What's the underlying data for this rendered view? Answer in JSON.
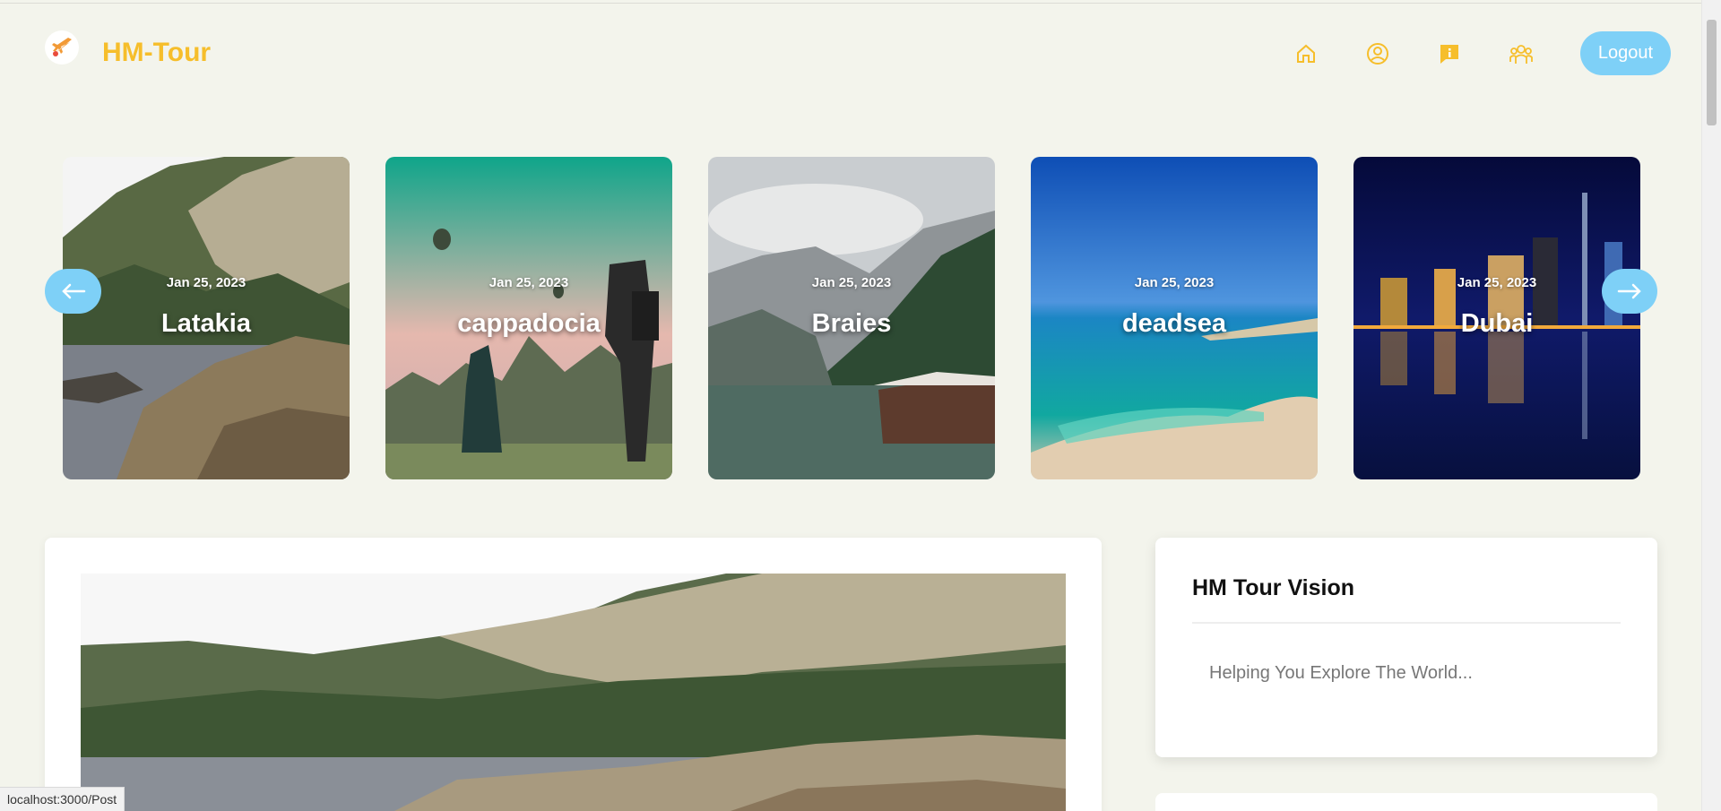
{
  "app": {
    "brand": "HM-Tour",
    "logout_label": "Logout"
  },
  "nav": {
    "icons": [
      "home-icon",
      "user-icon",
      "info-icon",
      "group-icon"
    ],
    "accent": "#f6be2b",
    "button_color": "#7ed0f7"
  },
  "carousel": {
    "cards": [
      {
        "date": "Jan 25, 2023",
        "title": "Latakia"
      },
      {
        "date": "Jan 25, 2023",
        "title": "cappadocia"
      },
      {
        "date": "Jan 25, 2023",
        "title": "Braies"
      },
      {
        "date": "Jan 25, 2023",
        "title": "deadsea"
      },
      {
        "date": "Jan 25, 2023",
        "title": "Dubai"
      }
    ]
  },
  "vision": {
    "title": "HM Tour Vision",
    "text": "Helping You Explore The World..."
  },
  "status_bar": {
    "url": "localhost:3000/Post"
  }
}
